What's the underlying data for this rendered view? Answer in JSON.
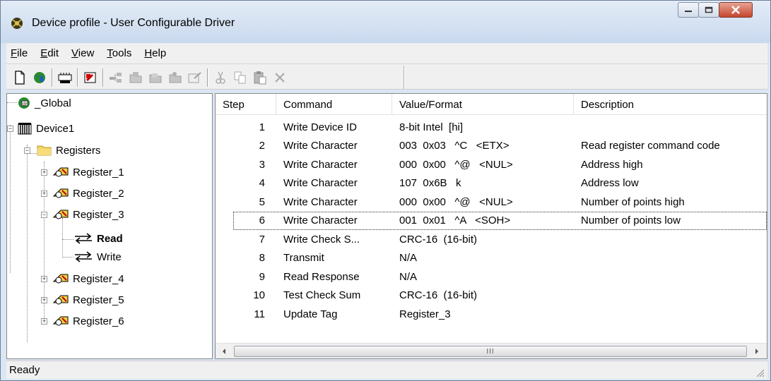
{
  "window": {
    "title": "Device profile - User Configurable Driver",
    "controls": {
      "minimize": "minimize-icon",
      "maximize": "maximize-icon",
      "close": "close-icon"
    }
  },
  "menu": [
    {
      "label": "File",
      "mnemonic": "F",
      "rest": "ile"
    },
    {
      "label": "Edit",
      "mnemonic": "E",
      "rest": "dit"
    },
    {
      "label": "View",
      "mnemonic": "V",
      "rest": "iew"
    },
    {
      "label": "Tools",
      "mnemonic": "T",
      "rest": "ools"
    },
    {
      "label": "Help",
      "mnemonic": "H",
      "rest": "elp"
    }
  ],
  "toolbar": {
    "icons": [
      "new-document-icon",
      "global-icon",
      "device-icon",
      "register-icon",
      "add-tag-icon",
      "folder-icon",
      "folder-open-icon",
      "folder-read-icon",
      "properties-icon",
      "cut-icon",
      "copy-icon",
      "paste-icon",
      "delete-icon"
    ]
  },
  "tree": {
    "global_label": "_Global",
    "device_label": "Device1",
    "registers_label": "Registers",
    "registers": [
      "Register_1",
      "Register_2",
      "Register_3",
      "Register_4",
      "Register_5",
      "Register_6"
    ],
    "read_label": "Read",
    "write_label": "Write"
  },
  "list": {
    "columns": [
      "Step",
      "Command",
      "Value/Format",
      "Description"
    ],
    "rows": [
      {
        "step": "1",
        "command": "Write Device ID",
        "value": "8-bit Intel  [hi]",
        "description": ""
      },
      {
        "step": "2",
        "command": "Write Character",
        "value": "003  0x03   ^C   <ETX>",
        "description": "Read register command code"
      },
      {
        "step": "3",
        "command": "Write Character",
        "value": "000  0x00   ^@   <NUL>",
        "description": "Address high"
      },
      {
        "step": "4",
        "command": "Write Character",
        "value": "107  0x6B   k",
        "description": "Address low"
      },
      {
        "step": "5",
        "command": "Write Character",
        "value": "000  0x00   ^@   <NUL>",
        "description": "Number of points high"
      },
      {
        "step": "6",
        "command": "Write Character",
        "value": "001  0x01   ^A   <SOH>",
        "description": "Number of points low"
      },
      {
        "step": "7",
        "command": "Write Check S...",
        "value": "CRC-16  (16-bit)",
        "description": ""
      },
      {
        "step": "8",
        "command": "Transmit",
        "value": "N/A",
        "description": ""
      },
      {
        "step": "9",
        "command": "Read Response",
        "value": "N/A",
        "description": ""
      },
      {
        "step": "10",
        "command": "Test Check Sum",
        "value": "CRC-16  (16-bit)",
        "description": ""
      },
      {
        "step": "11",
        "command": "Update Tag",
        "value": "Register_3",
        "description": ""
      }
    ],
    "scroll_thumb_grip": "III"
  },
  "status": {
    "text": "Ready"
  }
}
